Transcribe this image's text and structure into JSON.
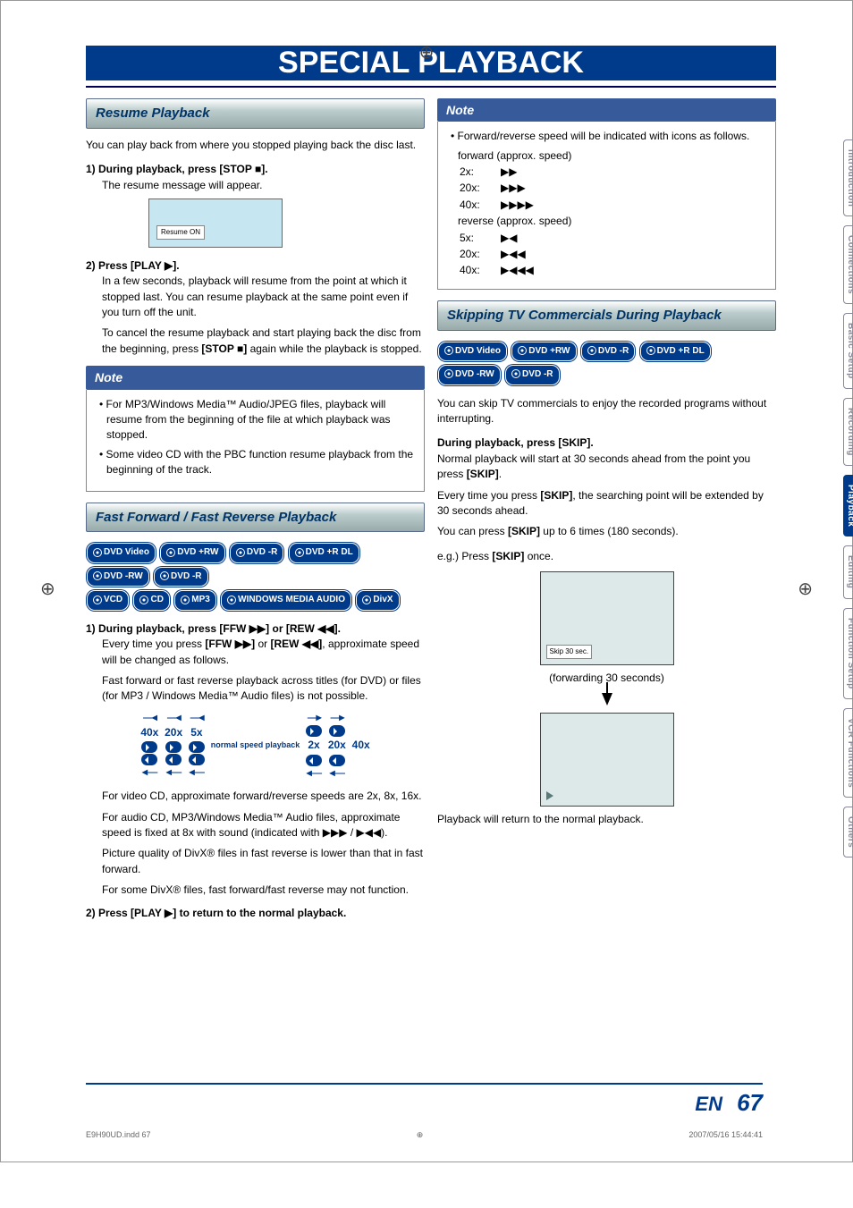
{
  "title": "SPECIAL PLAYBACK",
  "tabs": [
    "Introduction",
    "Connections",
    "Basic Setup",
    "Recording",
    "Playback",
    "Editing",
    "Function Setup",
    "VCR Functions",
    "Others"
  ],
  "active_tab": 4,
  "resume": {
    "heading": "Resume Playback",
    "intro": "You can play back from where you stopped playing back the disc last.",
    "step1_label": "1) During playback, press [STOP ■].",
    "step1_text": "The resume message will appear.",
    "resume_box_label": "Resume ON",
    "step2_label": "2) Press [PLAY ▶].",
    "step2_text1": "In a few seconds, playback will resume from the point at which it stopped last. You can resume playback at the same point even if you turn off the unit.",
    "step2_text2a": "To cancel the resume playback and start playing back the disc from the beginning, press ",
    "step2_text2b": "[STOP ■]",
    "step2_text2c": " again while the playback is stopped.",
    "note_head": "Note",
    "note1": "For MP3/Windows Media™ Audio/JPEG files, playback will resume from the beginning of the file at which playback was stopped.",
    "note2": "Some video CD with the PBC function resume playback from the beginning of the track."
  },
  "ff": {
    "heading": "Fast Forward / Fast Reverse Playback",
    "formats_row1": [
      "DVD Video",
      "DVD +RW",
      "DVD -R",
      "DVD +R DL",
      "DVD -RW",
      "DVD -R"
    ],
    "formats_row2": [
      "VCD",
      "CD",
      "MP3",
      "WINDOWS MEDIA AUDIO",
      "DivX"
    ],
    "step1_label": "1) During playback, press [FFW ▶▶] or [REW ◀◀].",
    "step1_text1a": "Every time you press ",
    "step1_text1b": "[FFW ▶▶]",
    "step1_text1c": " or ",
    "step1_text1d": "[REW ◀◀]",
    "step1_text1e": ", approximate speed will be changed as follows.",
    "step1_text2": "Fast forward or fast reverse playback across titles (for DVD) or files (for MP3 / Windows Media™ Audio files) is not possible.",
    "speed_rev": [
      "40x",
      "20x",
      "5x"
    ],
    "speed_center": "normal speed playback",
    "speed_fwd": [
      "2x",
      "20x",
      "40x"
    ],
    "vcd_note": "For video CD, approximate forward/reverse speeds are 2x, 8x, 16x.",
    "audio_note": "For audio CD, MP3/Windows Media™ Audio files, approximate speed is fixed at 8x with sound (indicated with ▶▶▶ / ▶◀◀).",
    "divx_note1": "Picture quality of DivX® files in fast reverse is lower than that in fast forward.",
    "divx_note2": "For some DivX® files, fast forward/fast reverse may not function.",
    "step2_label": "2) Press [PLAY ▶] to return to the normal playback."
  },
  "speed_note": {
    "note_head": "Note",
    "intro": "Forward/reverse speed will be indicated with icons as follows.",
    "fwd_label": "forward (approx. speed)",
    "fwd": [
      {
        "speed": "2x:",
        "arrows": "▶▶"
      },
      {
        "speed": "20x:",
        "arrows": "▶▶▶"
      },
      {
        "speed": "40x:",
        "arrows": "▶▶▶▶"
      }
    ],
    "rev_label": "reverse (approx. speed)",
    "rev": [
      {
        "speed": "5x:",
        "arrows": "▶◀"
      },
      {
        "speed": "20x:",
        "arrows": "▶◀◀"
      },
      {
        "speed": "40x:",
        "arrows": "▶◀◀◀"
      }
    ]
  },
  "skip": {
    "heading": "Skipping TV Commercials During Playback",
    "formats": [
      "DVD Video",
      "DVD +RW",
      "DVD -R",
      "DVD +R DL",
      "DVD -RW",
      "DVD -R"
    ],
    "intro": "You can skip TV commercials to enjoy the recorded programs without interrupting.",
    "step_label": "During playback, press [SKIP].",
    "text1a": "Normal playback will start at 30 seconds ahead from the point you press ",
    "text1b": "[SKIP]",
    "text1c": ".",
    "text2a": "Every time you press ",
    "text2b": "[SKIP]",
    "text2c": ", the searching point will be extended by 30 seconds ahead.",
    "text3a": "You can press ",
    "text3b": "[SKIP]",
    "text3c": " up to 6 times (180 seconds).",
    "eg_label": "e.g.) Press ",
    "eg_bold": "[SKIP]",
    "eg_after": " once.",
    "skip_tag": "Skip 30 sec.",
    "forward_label": "(forwarding 30 seconds)",
    "final": "Playback will return to the normal playback."
  },
  "footer": {
    "lang": "EN",
    "page": "67"
  },
  "meta": {
    "file": "E9H90UD.indd   67",
    "timestamp": "2007/05/16   15:44:41"
  }
}
